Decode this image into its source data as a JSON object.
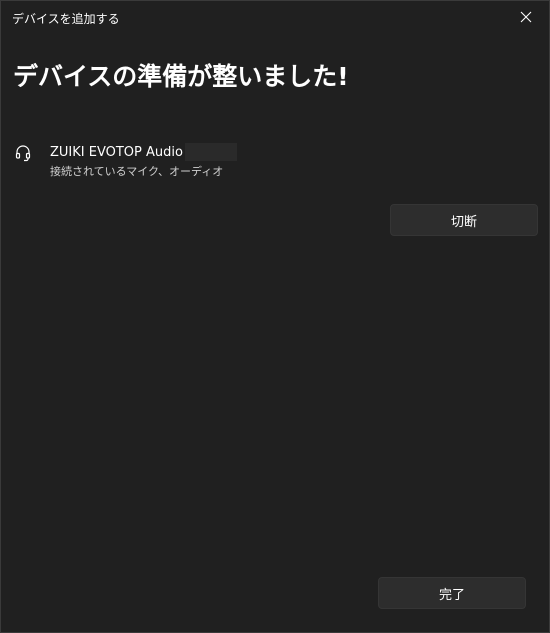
{
  "window": {
    "title": "デバイスを追加する"
  },
  "main": {
    "heading": "デバイスの準備が整いました!"
  },
  "device": {
    "name": "ZUIKI EVOTOP Audio",
    "status": "接続されているマイク、オーディオ",
    "icon": "headset-icon"
  },
  "buttons": {
    "disconnect_label": "切断",
    "done_label": "完了"
  },
  "colors": {
    "background": "#202020",
    "button": "#2d2d2d",
    "text": "#ffffff",
    "secondary_text": "#cfcfcf"
  }
}
